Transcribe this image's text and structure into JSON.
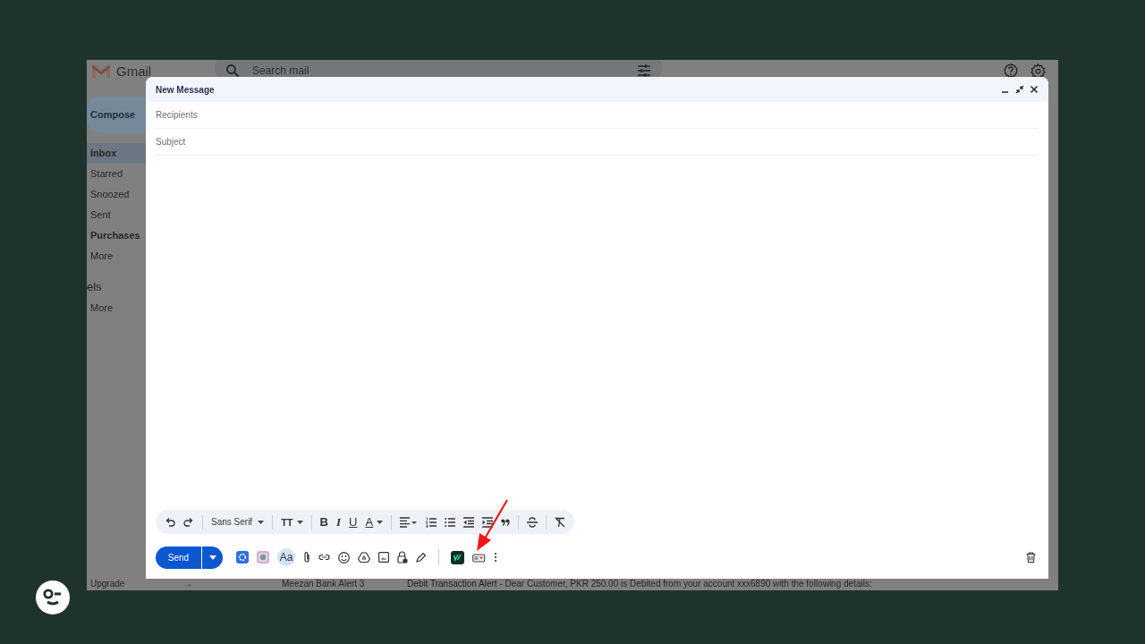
{
  "gmail": {
    "logo_text": "Gmail",
    "search": {
      "placeholder": "Search mail"
    },
    "compose_label": "Compose",
    "nav": [
      {
        "label": "Inbox",
        "selected": true,
        "bold": true
      },
      {
        "label": "Starred",
        "selected": false,
        "bold": false
      },
      {
        "label": "Snoozed",
        "selected": false,
        "bold": false
      },
      {
        "label": "Sent",
        "selected": false,
        "bold": false
      },
      {
        "label": "Purchases",
        "selected": false,
        "bold": true
      },
      {
        "label": "More",
        "selected": false,
        "bold": false
      }
    ],
    "labels_heading": "els",
    "labels_more": "More",
    "bottom_row": {
      "upgrade": "Upgrade",
      "arrow": "→",
      "sender": "Meezan Bank Alert 3",
      "subject": "Debit Transaction Alert",
      "snippet": " - Dear Customer, PKR 250.00 is Debited from your account xxx6890 with the following details:"
    }
  },
  "compose": {
    "title": "New Message",
    "recipients": {
      "placeholder": "Recipients"
    },
    "subject": {
      "placeholder": "Subject"
    },
    "font": "Sans Serif",
    "text_size": "TT",
    "format_letters": [
      "B",
      "I",
      "U",
      "A"
    ],
    "send": "Send",
    "text_style": "Aa"
  }
}
